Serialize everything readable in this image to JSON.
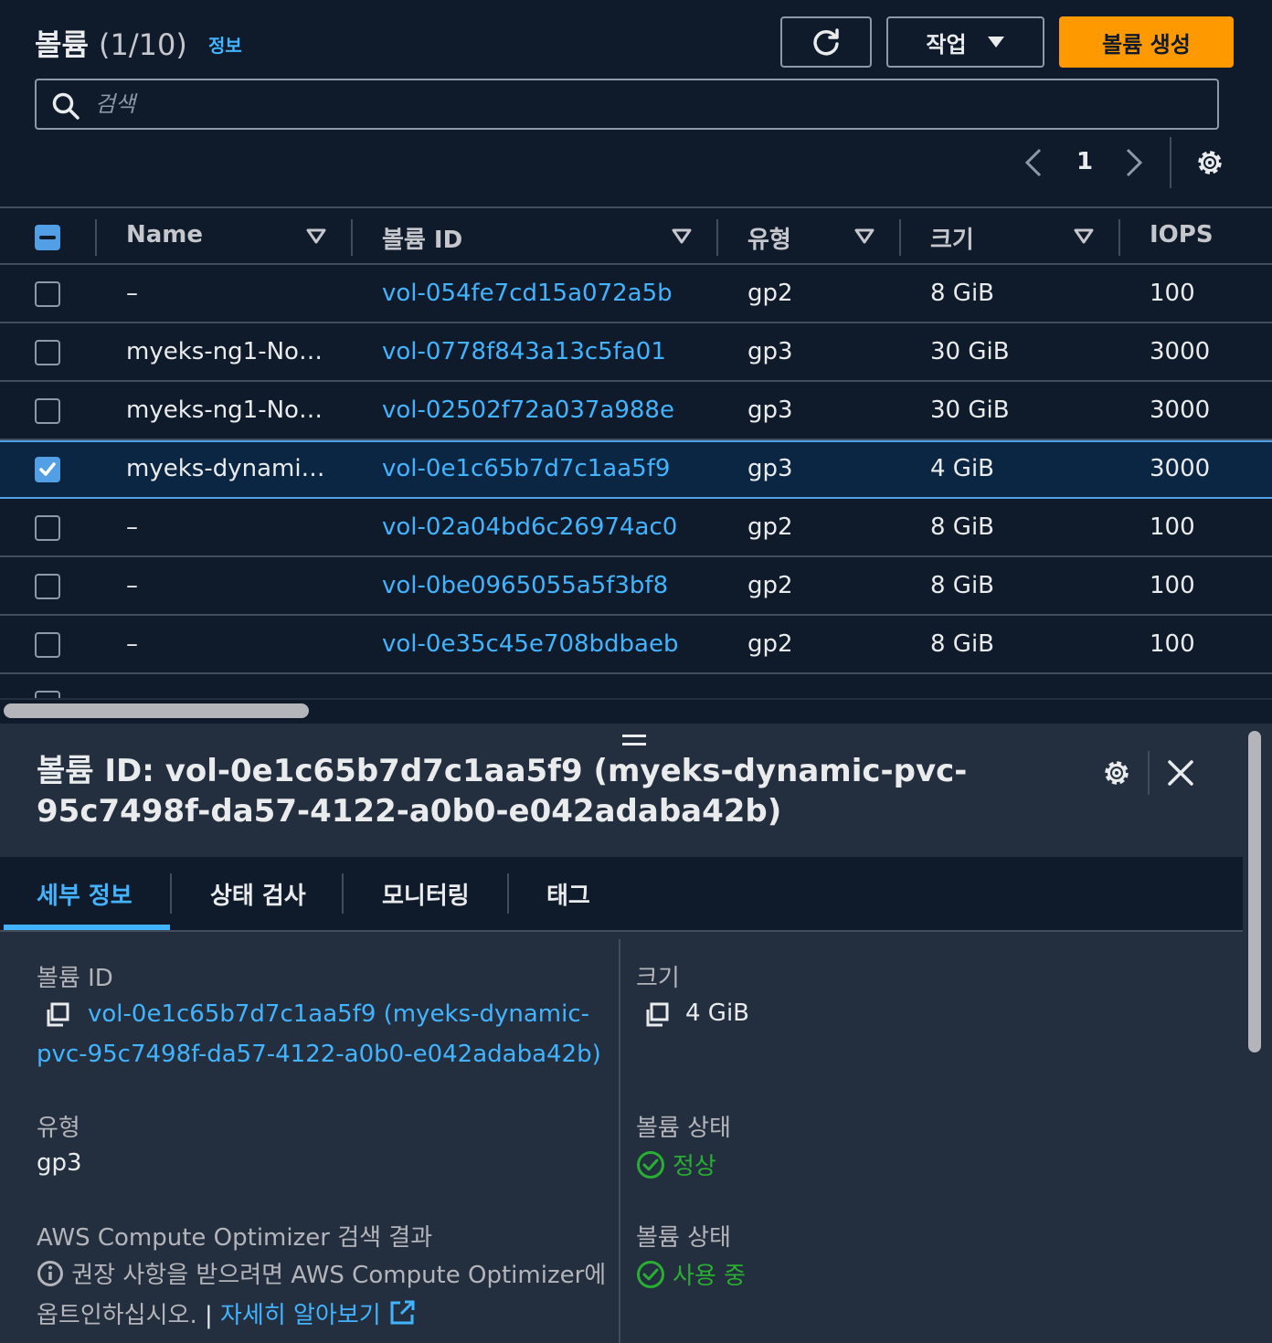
{
  "header": {
    "title": "볼륨",
    "count": "(1/10)",
    "info_link": "정보",
    "actions_label": "작업",
    "create_label": "볼륨 생성",
    "search_placeholder": "검색",
    "page_number": "1"
  },
  "table": {
    "columns": [
      "Name",
      "볼륨 ID",
      "유형",
      "크기",
      "IOPS"
    ],
    "rows": [
      {
        "name": "–",
        "volume_id": "vol-054fe7cd15a072a5b",
        "type": "gp2",
        "size": "8 GiB",
        "iops": "100",
        "selected": false
      },
      {
        "name": "myeks-ng1-No…",
        "volume_id": "vol-0778f843a13c5fa01",
        "type": "gp3",
        "size": "30 GiB",
        "iops": "3000",
        "selected": false
      },
      {
        "name": "myeks-ng1-No…",
        "volume_id": "vol-02502f72a037a988e",
        "type": "gp3",
        "size": "30 GiB",
        "iops": "3000",
        "selected": false
      },
      {
        "name": "myeks-dynami…",
        "volume_id": "vol-0e1c65b7d7c1aa5f9",
        "type": "gp3",
        "size": "4 GiB",
        "iops": "3000",
        "selected": true
      },
      {
        "name": "–",
        "volume_id": "vol-02a04bd6c26974ac0",
        "type": "gp2",
        "size": "8 GiB",
        "iops": "100",
        "selected": false
      },
      {
        "name": "–",
        "volume_id": "vol-0be0965055a5f3bf8",
        "type": "gp2",
        "size": "8 GiB",
        "iops": "100",
        "selected": false
      },
      {
        "name": "–",
        "volume_id": "vol-0e35c45e708bdbaeb",
        "type": "gp2",
        "size": "8 GiB",
        "iops": "100",
        "selected": false
      }
    ]
  },
  "panel": {
    "title": "볼륨 ID: vol-0e1c65b7d7c1aa5f9 (myeks-dynamic-pvc-95c7498f-da57-4122-a0b0-e042adaba42b)",
    "tabs": [
      "세부 정보",
      "상태 검사",
      "모니터링",
      "태그"
    ],
    "active_tab": 0,
    "details": {
      "volume_id_label": "볼륨 ID",
      "volume_id_value": "vol-0e1c65b7d7c1aa5f9 (myeks-dynamic-pvc-95c7498f-da57-4122-a0b0-e042adaba42b)",
      "size_label": "크기",
      "size_value": "4 GiB",
      "type_label": "유형",
      "type_value": "gp3",
      "volume_state_label": "볼륨 상태",
      "volume_state_value": "정상",
      "volume_status_label": "볼륨 상태",
      "volume_status_value": "사용 중",
      "optimizer_label": "AWS Compute Optimizer 검색 결과",
      "optimizer_text": "권장 사항을 받으려면 AWS Compute Optimizer에 옵트인하십시오.",
      "optimizer_separator": "|",
      "learn_more": "자세히 알아보기"
    }
  },
  "colors": {
    "accent": "#42b4ff",
    "primary_button": "#ff9900",
    "success": "#29ad32",
    "background": "#0f1b2a",
    "panel": "#232f3e"
  }
}
